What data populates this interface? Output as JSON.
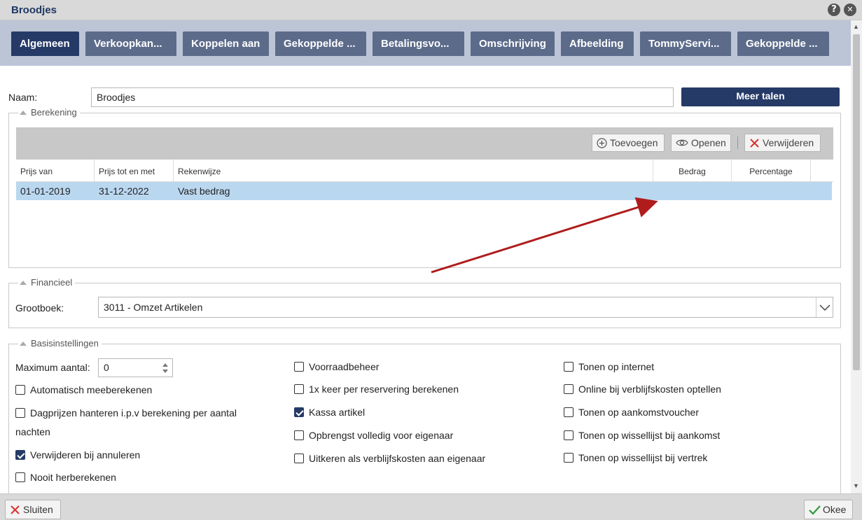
{
  "window": {
    "title": "Broodjes",
    "help_icon": "?",
    "close_icon": "✕"
  },
  "tabs": [
    {
      "label": "Algemeen",
      "active": true
    },
    {
      "label": "Verkoopkan..."
    },
    {
      "label": "Koppelen aan"
    },
    {
      "label": "Gekoppelde ..."
    },
    {
      "label": "Betalingsvo..."
    },
    {
      "label": "Omschrijving"
    },
    {
      "label": "Afbeelding"
    },
    {
      "label": "TommyServi..."
    },
    {
      "label": "Gekoppelde ..."
    }
  ],
  "form": {
    "name_label": "Naam:",
    "name_value": "Broodjes",
    "languages_button": "Meer talen"
  },
  "berekening": {
    "legend": "Berekening",
    "toolbar": {
      "add": "Toevoegen",
      "open": "Openen",
      "delete": "Verwijderen"
    },
    "columns": [
      "Prijs van",
      "Prijs tot en met",
      "Rekenwijze",
      "Bedrag",
      "Percentage"
    ],
    "rows": [
      {
        "from": "01-01-2019",
        "to": "31-12-2022",
        "method": "Vast bedrag",
        "amount": "",
        "percentage": ""
      }
    ]
  },
  "financieel": {
    "legend": "Financieel",
    "ledger_label": "Grootboek:",
    "ledger_value": "3011 - Omzet Artikelen"
  },
  "basis": {
    "legend": "Basisinstellingen",
    "max_label": "Maximum aantal:",
    "max_value": "0",
    "col1": [
      {
        "label": "Automatisch meeberekenen",
        "checked": false
      },
      {
        "label": "Dagprijzen hanteren i.p.v berekening per aantal",
        "label2": "nachten",
        "checked": false
      },
      {
        "label": "Verwijderen bij annuleren",
        "checked": true
      },
      {
        "label": "Nooit herberekenen",
        "checked": false
      }
    ],
    "col2": [
      {
        "label": "Voorraadbeheer",
        "checked": false
      },
      {
        "label": "1x keer per reservering berekenen",
        "checked": false
      },
      {
        "label": "Kassa artikel",
        "checked": true
      },
      {
        "label": "Opbrengst volledig voor eigenaar",
        "checked": false
      },
      {
        "label": "Uitkeren als verblijfskosten aan eigenaar",
        "checked": false
      }
    ],
    "col3": [
      {
        "label": "Tonen op internet",
        "checked": false
      },
      {
        "label": "Online bij verblijfskosten optellen",
        "checked": false
      },
      {
        "label": "Tonen op aankomstvoucher",
        "checked": false
      },
      {
        "label": "Tonen op wissellijst bij aankomst",
        "checked": false
      },
      {
        "label": "Tonen op wissellijst bij vertrek",
        "checked": false
      }
    ]
  },
  "footer": {
    "close": "Sluiten",
    "ok": "Okee"
  },
  "colors": {
    "primary": "#253a66",
    "tab": "#5c6b8a",
    "row_selected": "#bad7f0",
    "annotation_arrow": "#b01c1c"
  }
}
